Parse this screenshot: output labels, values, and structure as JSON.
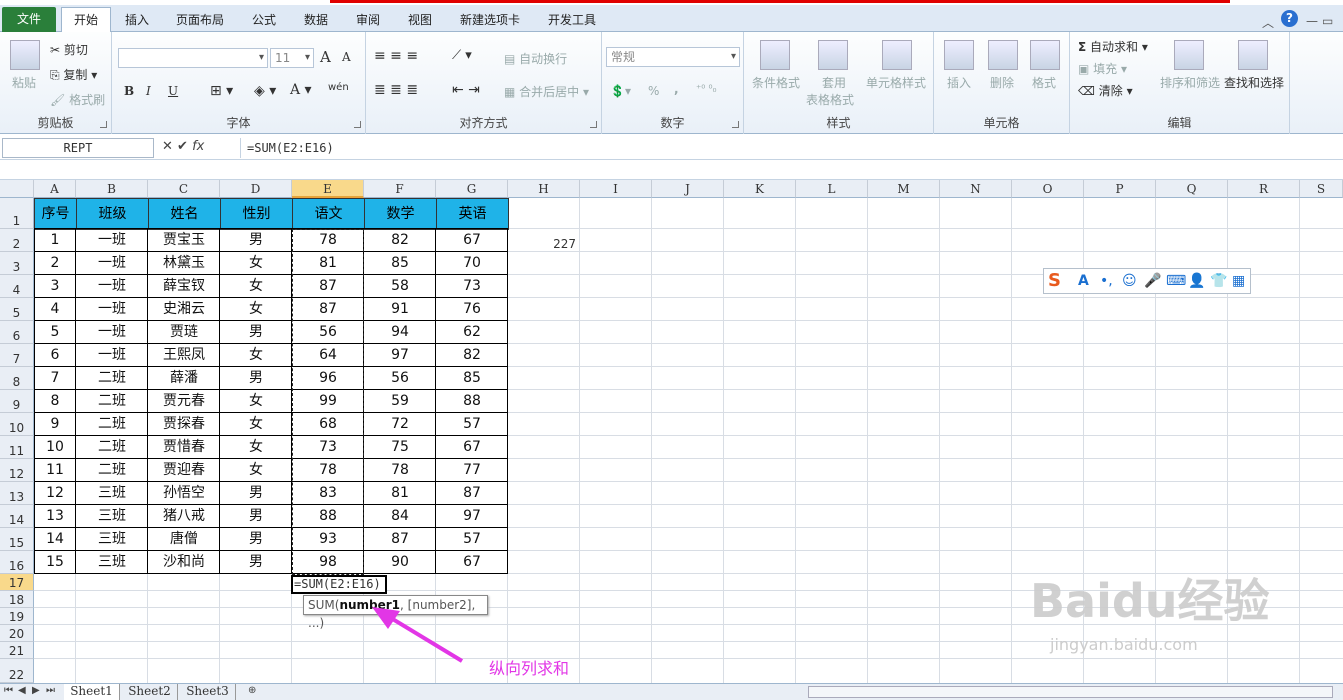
{
  "ribbon_tabs": [
    "文件",
    "开始",
    "插入",
    "页面布局",
    "公式",
    "数据",
    "审阅",
    "视图",
    "新建选项卡",
    "开发工具"
  ],
  "clipboard": {
    "paste": "粘贴",
    "cut": "剪切",
    "copy": "复制",
    "format_painter": "格式刷",
    "label": "剪贴板"
  },
  "font": {
    "size": "11",
    "label": "字体",
    "bold": "B",
    "italic": "I",
    "underline": "U",
    "big_a": "A",
    "small_a": "A",
    "wen": "wén"
  },
  "alignment": {
    "wrap": "自动换行",
    "merge": "合并后居中",
    "label": "对齐方式"
  },
  "number": {
    "format": "常规",
    "percent": "%",
    "comma": ",",
    "label": "数字"
  },
  "styles": {
    "cond": "条件格式",
    "table1": "套用",
    "table2": "表格格式",
    "cell": "单元格样式",
    "label": "样式"
  },
  "cells": {
    "insert": "插入",
    "delete": "删除",
    "format": "格式",
    "label": "单元格"
  },
  "editing": {
    "autosum": "自动求和",
    "fill": "填充",
    "clear": "清除",
    "sort": "排序和筛选",
    "find": "查找和选择",
    "label": "编辑",
    "sigma": "Σ"
  },
  "formula_bar": {
    "name": "REPT",
    "formula": "=SUM(E2:E16)",
    "x": "✕",
    "check": "✔",
    "fx": "fx"
  },
  "columns": [
    "A",
    "B",
    "C",
    "D",
    "E",
    "F",
    "G",
    "H",
    "I",
    "J",
    "K",
    "L",
    "M",
    "N",
    "O",
    "P",
    "Q",
    "R",
    "S"
  ],
  "rows": [
    "1",
    "2",
    "3",
    "4",
    "5",
    "6",
    "7",
    "8",
    "9",
    "10",
    "11",
    "12",
    "13",
    "14",
    "15",
    "16",
    "17",
    "18",
    "19",
    "20",
    "21",
    "22"
  ],
  "table": {
    "header": [
      "序号",
      "班级",
      "姓名",
      "性别",
      "语文",
      "数学",
      "英语"
    ],
    "data": [
      [
        "1",
        "一班",
        "贾宝玉",
        "男",
        "78",
        "82",
        "67"
      ],
      [
        "2",
        "一班",
        "林黛玉",
        "女",
        "81",
        "85",
        "70"
      ],
      [
        "3",
        "一班",
        "薛宝钗",
        "女",
        "87",
        "58",
        "73"
      ],
      [
        "4",
        "一班",
        "史湘云",
        "女",
        "87",
        "91",
        "76"
      ],
      [
        "5",
        "一班",
        "贾琏",
        "男",
        "56",
        "94",
        "62"
      ],
      [
        "6",
        "一班",
        "王熙凤",
        "女",
        "64",
        "97",
        "82"
      ],
      [
        "7",
        "二班",
        "薛潘",
        "男",
        "96",
        "56",
        "85"
      ],
      [
        "8",
        "二班",
        "贾元春",
        "女",
        "99",
        "59",
        "88"
      ],
      [
        "9",
        "二班",
        "贾探春",
        "女",
        "68",
        "72",
        "57"
      ],
      [
        "10",
        "二班",
        "贾惜春",
        "女",
        "73",
        "75",
        "67"
      ],
      [
        "11",
        "二班",
        "贾迎春",
        "女",
        "78",
        "78",
        "77"
      ],
      [
        "12",
        "三班",
        "孙悟空",
        "男",
        "83",
        "81",
        "87"
      ],
      [
        "13",
        "三班",
        "猪八戒",
        "男",
        "88",
        "84",
        "97"
      ],
      [
        "14",
        "三班",
        "唐僧",
        "男",
        "93",
        "87",
        "57"
      ],
      [
        "15",
        "三班",
        "沙和尚",
        "男",
        "98",
        "90",
        "67"
      ]
    ]
  },
  "h2_value": "227",
  "edit_cell": "=SUM(E2:E16)",
  "tooltip": {
    "fn": "SUM(",
    "arg1": "number1",
    ", [number2], ...)": "",
    "rest": ", [number2], ...)"
  },
  "annotation": "纵向列求和",
  "sheets": [
    "Sheet1",
    "Sheet2",
    "Sheet3"
  ],
  "watermark": {
    "main": "Baidu经验",
    "sub": "jingyan.baidu.com"
  },
  "colors": {
    "header_fill": "#1fb3e8",
    "accent": "#2a7f3a",
    "annotation": "#e236e6"
  }
}
